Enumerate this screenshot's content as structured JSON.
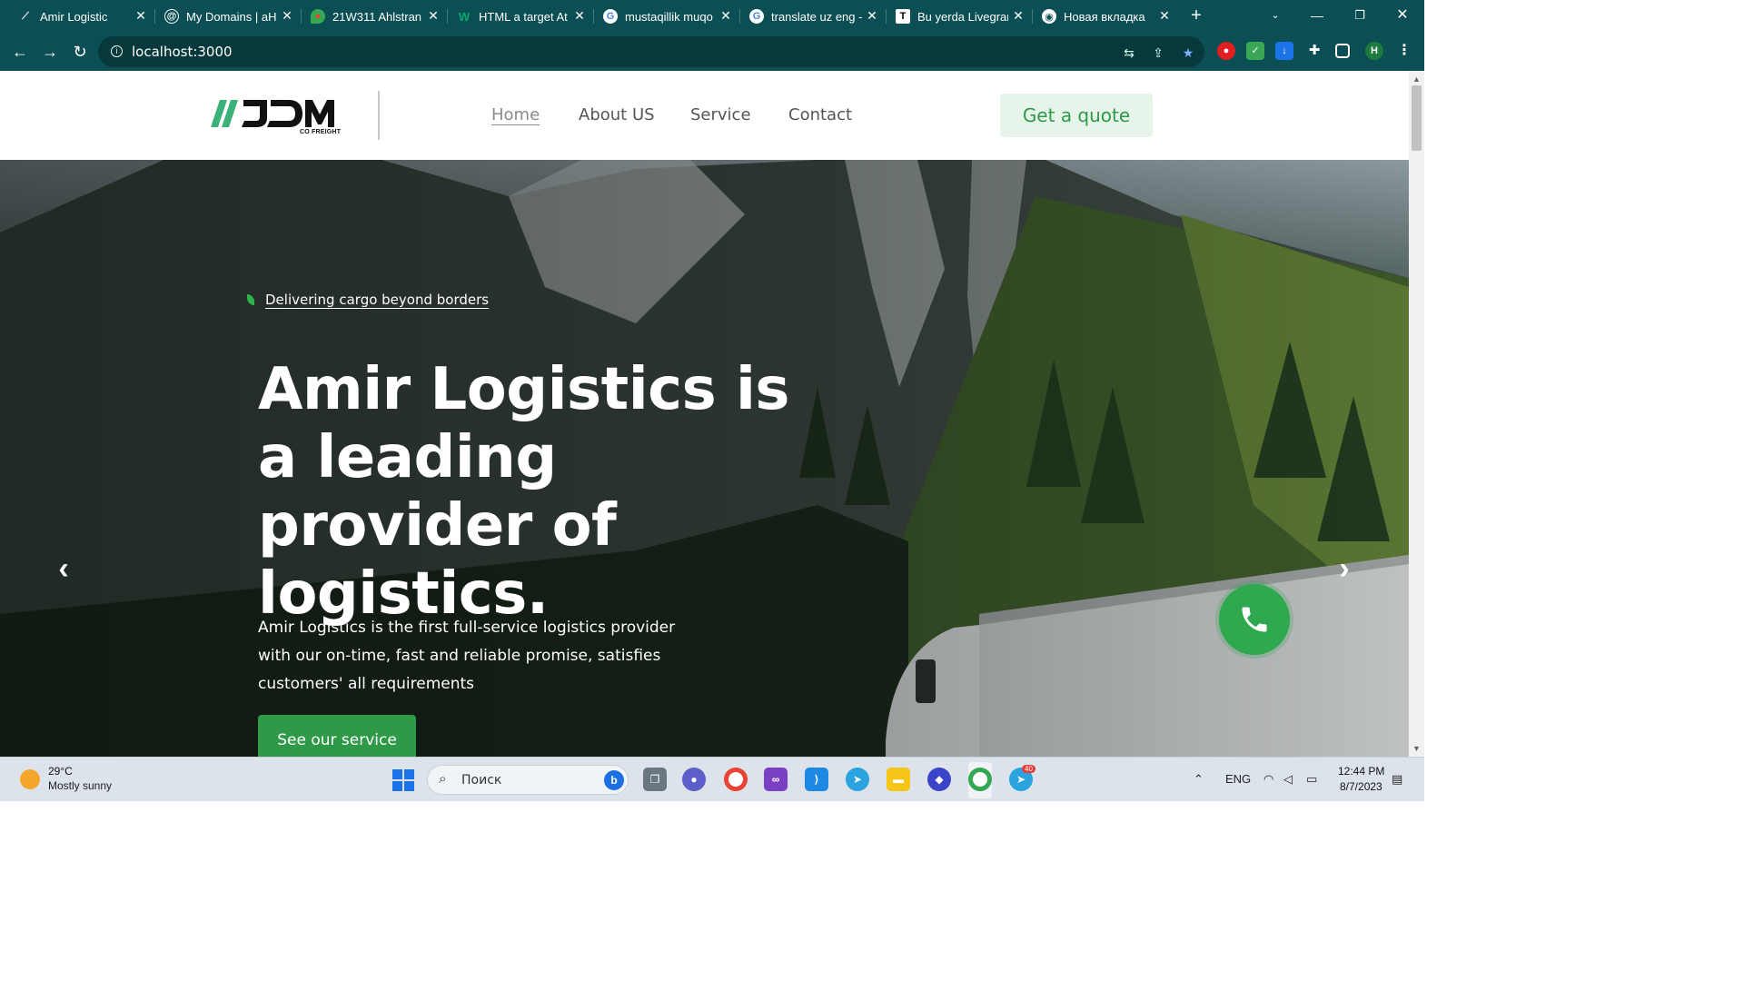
{
  "browser": {
    "tabs": [
      {
        "title": "Amir Logistic",
        "favicon": "amir-logistic-icon"
      },
      {
        "title": "My Domains | aH",
        "favicon": "at-sign-icon"
      },
      {
        "title": "21W311 Ahlstran",
        "favicon": "maps-pin-icon"
      },
      {
        "title": "HTML a target At",
        "favicon": "w3-icon"
      },
      {
        "title": "mustaqillik muqo",
        "favicon": "google-icon"
      },
      {
        "title": "translate uz eng -",
        "favicon": "google-icon"
      },
      {
        "title": "Bu yerda Livegran",
        "favicon": "t-icon"
      },
      {
        "title": "Новая вкладка",
        "favicon": "chrome-icon"
      }
    ],
    "url": "localhost:3000",
    "profile_initial": "H",
    "accent": "#0b4f55"
  },
  "site": {
    "logo_text": "JDM",
    "logo_sub": "CO FREIGHT",
    "nav": [
      "Home",
      "About US",
      "Service",
      "Contact"
    ],
    "quote_button": "Get a quote",
    "tagline": "Delivering cargo beyond borders",
    "hero_title": "Amir Logistics is a leading provider of logistics.",
    "hero_desc": "Amir Logistics is the first full-service logistics provider with our on-time, fast and reliable promise, satisfies customers' all requirements",
    "service_button": "See our service",
    "brand_green": "#2e9a47"
  },
  "taskbar": {
    "temperature": "29°C",
    "weather": "Mostly sunny",
    "search_placeholder": "Поиск",
    "language": "ENG",
    "time": "12:44 PM",
    "date": "8/7/2023",
    "telegram_badge": "40"
  }
}
